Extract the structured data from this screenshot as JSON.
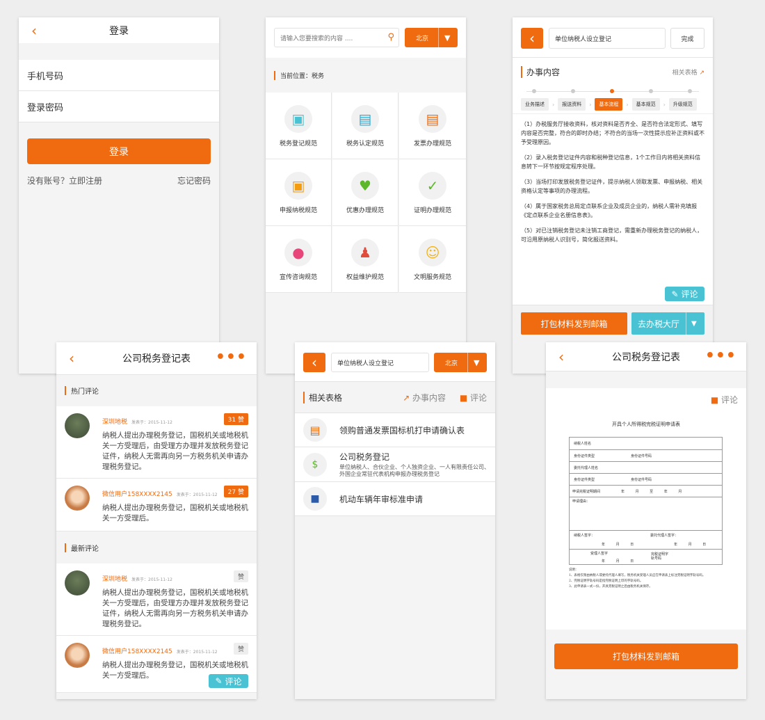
{
  "login": {
    "title": "登录",
    "phone_label": "手机号码",
    "password_label": "登录密码",
    "login_button": "登录",
    "register_link": "没有账号？立即注册",
    "forgot_link": "忘记密码"
  },
  "category": {
    "search_placeholder": "请输入您要搜索的内容 ....",
    "city": "北京",
    "location": "当前位置：税务",
    "items": [
      {
        "label": "税务登记规范",
        "icon": "document-icon"
      },
      {
        "label": "税务认定规范",
        "icon": "notepad-icon"
      },
      {
        "label": "发票办理规范",
        "icon": "invoice-icon"
      },
      {
        "label": "申报纳税规范",
        "icon": "monitor-icon"
      },
      {
        "label": "优惠办理规范",
        "icon": "heart-icon"
      },
      {
        "label": "证明办理规范",
        "icon": "map-check-icon"
      },
      {
        "label": "宣传咨询规范",
        "icon": "chat-bubble-icon"
      },
      {
        "label": "权益维护规范",
        "icon": "user-shield-icon"
      },
      {
        "label": "文明服务规范",
        "icon": "smile-icon"
      }
    ]
  },
  "process": {
    "search_value": "单位纳税人设立登记",
    "done_button": "完成",
    "section_title": "办事内容",
    "related_link": "相关表格",
    "steps": [
      "业务描述",
      "报送资料",
      "基本流程",
      "基本规范",
      "升级规范"
    ],
    "active_step": 2,
    "paragraphs": [
      "（1）办税服务厅接收资料，核对资料是否齐全、是否符合法定形式、填写内容是否完整，符合的即时办结；不符合的当场一次性提示应补正资料或不予受理原因。",
      "（2）录入税务登记证件内容和税种登记信息，1个工作日内将相关资料信息转下一环节按规定程序处理。",
      "（3）当场打印发放税务登记证件，提示纳税人领取发票、申报纳税、相关资格认定等事项的办理流程。",
      "（4）属于国家税务总局定点联系企业及成员企业的，纳税人需补充填报《定点联系企业名册信息表》。",
      "（5）对已注销税务登记未注销工商登记，需重新办理税务登记的纳税人，可沿用原纳税人识别号，简化报送资料。"
    ],
    "comment_button": "评论",
    "email_button": "打包材料发到邮箱",
    "hall_button": "去办税大厅"
  },
  "comments": {
    "title": "公司税务登记表",
    "hot_label": "热门评论",
    "latest_label": "最新评论",
    "hot": [
      {
        "user": "深圳地税",
        "date": "发表于：2015-11-12",
        "text": "纳税人提出办理税务登记，国税机关或地税机关一方受理后，由受理方办理并发放税务登记证件，纳税人无需再向另一方税务机关申请办理税务登记。",
        "likes": "31 赞"
      },
      {
        "user": "微信用户158XXXX2145",
        "date": "发表于：2015-11-12",
        "text": "纳税人提出办理税务登记，国税机关或地税机关一方受理后。",
        "likes": "27 赞"
      }
    ],
    "latest": [
      {
        "user": "深圳地税",
        "date": "发表于：2015-11-12",
        "text": "纳税人提出办理税务登记，国税机关或地税机关一方受理后，由受理方办理并发放税务登记证件，纳税人无需再向另一方税务机关申请办理税务登记。",
        "likes": "赞"
      },
      {
        "user": "微信用户158XXXX2145",
        "date": "发表于：2015-11-12",
        "text": "纳税人提出办理税务登记，国税机关或地税机关一方受理后。",
        "likes": "赞"
      }
    ],
    "comment_button": "评论"
  },
  "forms": {
    "search_value": "单位纳税人设立登记",
    "city": "北京",
    "section_title": "相关表格",
    "content_link": "办事内容",
    "comment_link": "评论",
    "items": [
      {
        "title": "领购普通发票国标机打申请确认表",
        "desc": "",
        "icon": "invoice-icon"
      },
      {
        "title": "公司税务登记",
        "desc": "单位纳税人、合伙企业、个人独资企业、一人有限责任公司、外国企业常驻代表机构申报办理税务登记",
        "icon": "money-bag-icon"
      },
      {
        "title": "机动车辆年审标准申请",
        "desc": "",
        "icon": "car-icon"
      }
    ]
  },
  "document": {
    "title": "公司税务登记表",
    "comment_link": "评论",
    "doc_title": "开具个人所得税完税证明申请表",
    "fields": [
      "纳税人姓名",
      "身份证件类型",
      "身份证件号码",
      "委托代理人姓名",
      "身份证件类型",
      "身份证件号码",
      "申请完税证明期间",
      "申请理由：",
      "纳税人签字：",
      "委托代理人签字：",
      "受理人签字",
      "完税证明字轨号码"
    ],
    "period_text": "年 月 至 年 月",
    "date_text": "年 月 日",
    "notes": [
      "说明：",
      "1、表格仅限由纳税人或委托代理人填写，税务机关受理人员应在申请表上标注完税证明字轨号码。",
      "2、完税证明字轨号码是指完税证明上印的字轨号码。",
      "3、此申请表一式一份，开具完税证明之后由税务机关保存。"
    ],
    "email_button": "打包材料发到邮箱"
  },
  "colors": {
    "accent": "#f06a0f",
    "cyan": "#49c3d4"
  }
}
